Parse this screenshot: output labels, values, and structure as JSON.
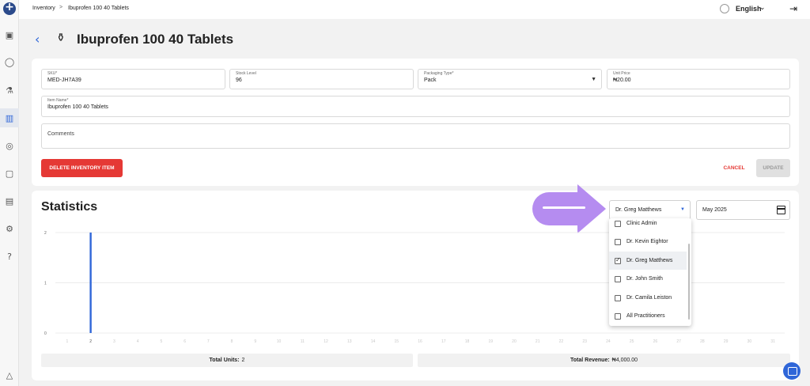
{
  "breadcrumb": {
    "parent": "Inventory",
    "separator": ">",
    "current": "Ibuprofen 100 40 Tablets"
  },
  "topbar": {
    "language": "English"
  },
  "header": {
    "title": "Ibuprofen 100 40 Tablets"
  },
  "form": {
    "sku": {
      "label": "SKU*",
      "value": "MED-JH7A39"
    },
    "stock": {
      "label": "Stock Level",
      "value": "96"
    },
    "packaging": {
      "label": "Packaging Type*",
      "value": "Pack"
    },
    "price": {
      "label": "Unit Price",
      "value": "₦20.00"
    },
    "item_name": {
      "label": "Item Name*",
      "value": "Ibuprofen 100 40 Tablets"
    },
    "comments": {
      "placeholder": "Comments"
    }
  },
  "actions": {
    "delete": "DELETE INVENTORY ITEM",
    "cancel": "CANCEL",
    "update": "UPDATE"
  },
  "statistics": {
    "title": "Statistics",
    "practitioner_selected": "Dr. Greg Matthews",
    "month": "May 2025",
    "dropdown_options": [
      {
        "label": "Clinic Admin",
        "checked": false
      },
      {
        "label": "Dr. Kevin Eightor",
        "checked": false
      },
      {
        "label": "Dr. Greg Matthews",
        "checked": true
      },
      {
        "label": "Dr. John Smith",
        "checked": false
      },
      {
        "label": "Dr. Camila Leiston",
        "checked": false
      },
      {
        "label": "All Practitioners",
        "checked": false
      }
    ],
    "total_units_label": "Total Units:",
    "total_units_value": "2",
    "total_revenue_label": "Total Revenue:",
    "total_revenue_value": "₦4,000.00"
  },
  "colors": {
    "accent": "#2f66d8",
    "danger": "#e53935",
    "arrow": "#b58cf0"
  },
  "chart_data": {
    "type": "bar",
    "x": [
      "1",
      "2",
      "3",
      "4",
      "5",
      "6",
      "7",
      "8",
      "9",
      "10",
      "11",
      "12",
      "13",
      "14",
      "15",
      "16",
      "17",
      "18",
      "19",
      "20",
      "21",
      "22",
      "23",
      "24",
      "25",
      "26",
      "27",
      "28",
      "29",
      "30",
      "31"
    ],
    "values": [
      0,
      2,
      0,
      0,
      0,
      0,
      0,
      0,
      0,
      0,
      0,
      0,
      0,
      0,
      0,
      0,
      0,
      0,
      0,
      0,
      0,
      0,
      0,
      0,
      0,
      0,
      0,
      0,
      0,
      0,
      0
    ],
    "yticks": [
      "0",
      "1",
      "2"
    ],
    "ylim": [
      0,
      2
    ],
    "grid": true
  }
}
